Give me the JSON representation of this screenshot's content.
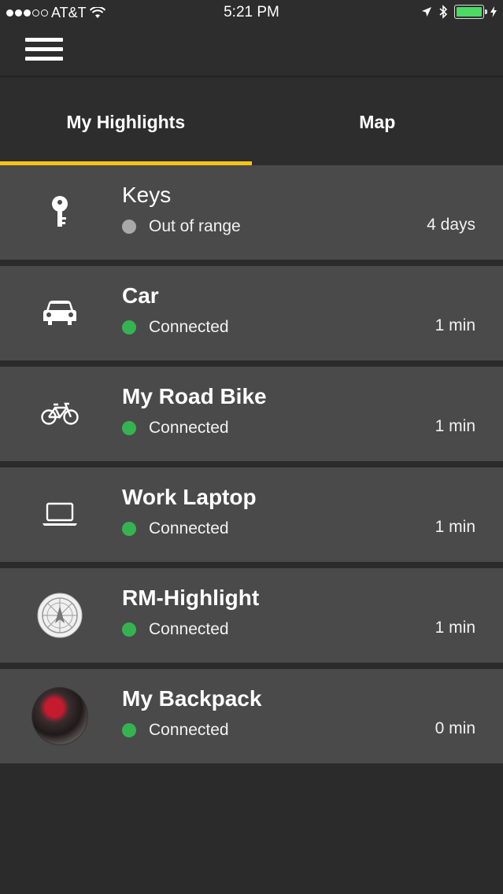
{
  "status_bar": {
    "carrier": "AT&T",
    "time": "5:21 PM"
  },
  "tabs": [
    {
      "label": "My Highlights",
      "active": true
    },
    {
      "label": "Map",
      "active": false
    }
  ],
  "devices": [
    {
      "name": "Keys",
      "status": "Out of range",
      "time": "4 days",
      "icon": "key-icon",
      "status_color": "#a9a9a9"
    },
    {
      "name": "Car",
      "status": "Connected",
      "time": "1 min",
      "icon": "car-icon",
      "status_color": "#35b351"
    },
    {
      "name": "My Road Bike",
      "status": "Connected",
      "time": "1 min",
      "icon": "bicycle-icon",
      "status_color": "#35b351"
    },
    {
      "name": "Work Laptop",
      "status": "Connected",
      "time": "1 min",
      "icon": "laptop-icon",
      "status_color": "#35b351"
    },
    {
      "name": "RM-Highlight",
      "status": "Connected",
      "time": "1 min",
      "icon": "compass-badge-icon",
      "status_color": "#35b351"
    },
    {
      "name": "My Backpack",
      "status": "Connected",
      "time": "0 min",
      "icon": "backpack-photo",
      "status_color": "#35b351"
    }
  ],
  "colors": {
    "accent": "#f6c514",
    "connected": "#35b351",
    "out_of_range": "#a9a9a9",
    "row_bg": "#4a4a4b",
    "app_bg": "#2b2b2c"
  }
}
